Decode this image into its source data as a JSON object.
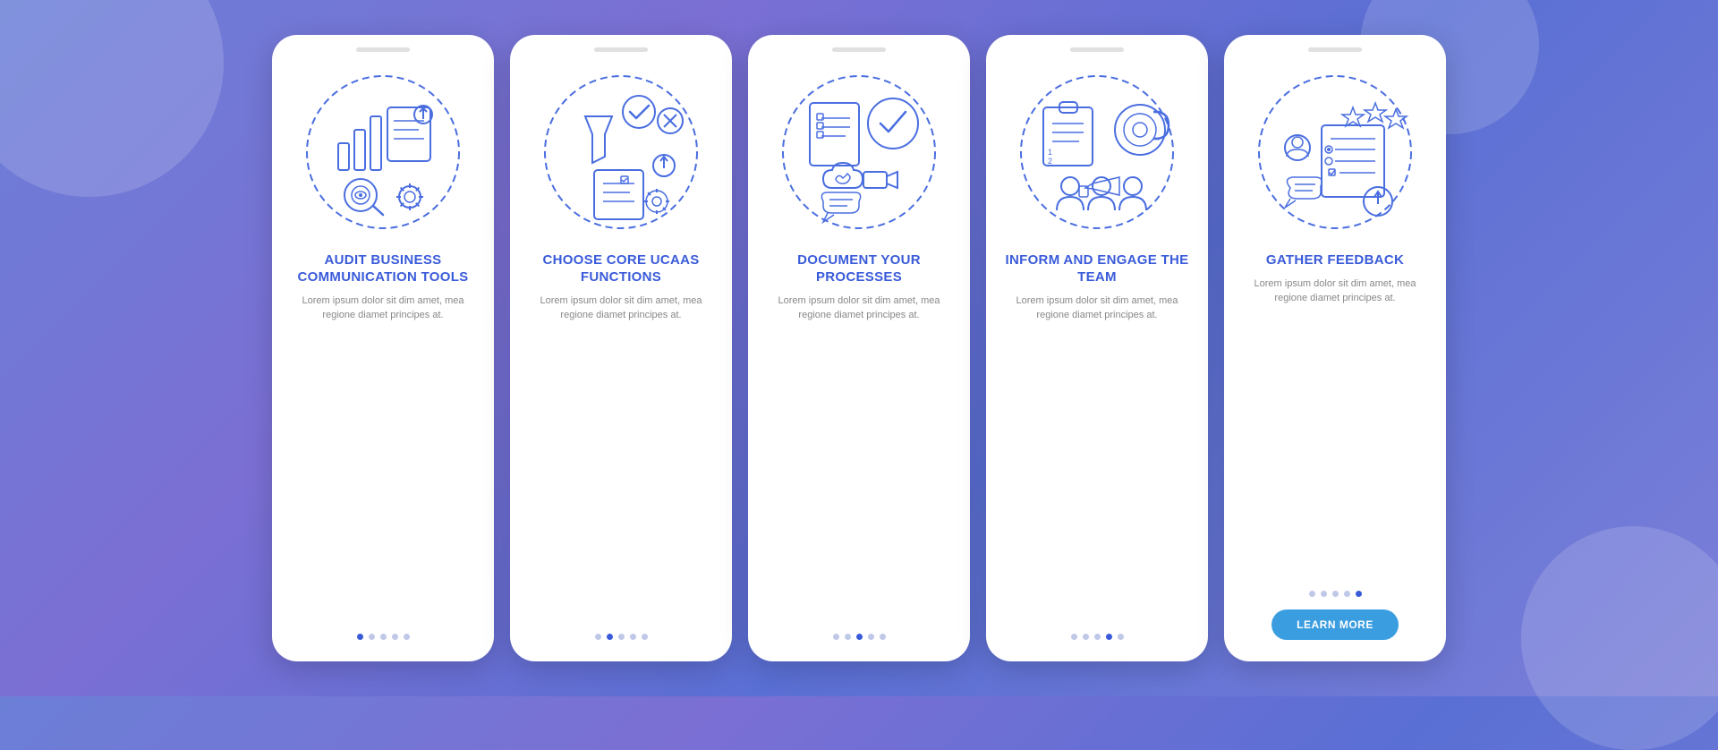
{
  "background": {
    "gradient_start": "#6b7fd7",
    "gradient_end": "#5a6fd4"
  },
  "cards": [
    {
      "id": "card-1",
      "title": "AUDIT BUSINESS COMMUNICATION TOOLS",
      "body": "Lorem ipsum dolor sit dim amet, mea regione diamet principes at.",
      "dots": [
        true,
        false,
        false,
        false,
        false
      ],
      "show_button": false,
      "button_label": ""
    },
    {
      "id": "card-2",
      "title": "CHOOSE CORE UCAAS FUNCTIONS",
      "body": "Lorem ipsum dolor sit dim amet, mea regione diamet principes at.",
      "dots": [
        false,
        true,
        false,
        false,
        false
      ],
      "show_button": false,
      "button_label": ""
    },
    {
      "id": "card-3",
      "title": "DOCUMENT YOUR PROCESSES",
      "body": "Lorem ipsum dolor sit dim amet, mea regione diamet principes at.",
      "dots": [
        false,
        false,
        true,
        false,
        false
      ],
      "show_button": false,
      "button_label": ""
    },
    {
      "id": "card-4",
      "title": "INFORM AND ENGAGE THE TEAM",
      "body": "Lorem ipsum dolor sit dim amet, mea regione diamet principes at.",
      "dots": [
        false,
        false,
        false,
        true,
        false
      ],
      "show_button": false,
      "button_label": ""
    },
    {
      "id": "card-5",
      "title": "GATHER FEEDBACK",
      "body": "Lorem ipsum dolor sit dim amet, mea regione diamet principes at.",
      "dots": [
        false,
        false,
        false,
        false,
        true
      ],
      "show_button": true,
      "button_label": "LEARN MORE"
    }
  ]
}
